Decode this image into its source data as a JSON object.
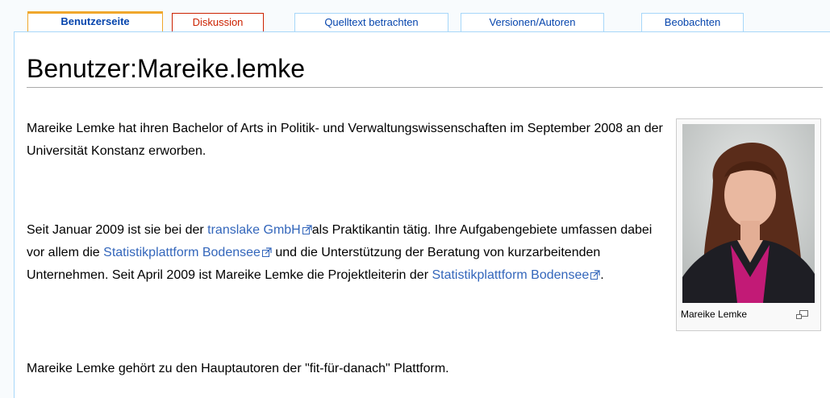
{
  "tabs": [
    {
      "label": "Benutzerseite",
      "state": "active"
    },
    {
      "label": "Diskussion",
      "state": "new"
    },
    {
      "label": "Quelltext betrachten",
      "state": "normal"
    },
    {
      "label": "Versionen/Autoren",
      "state": "normal"
    },
    {
      "label": "Beobachten",
      "state": "normal"
    }
  ],
  "page": {
    "title": "Benutzer:Mareike.lemke"
  },
  "paragraphs": {
    "p1": "Mareike Lemke hat ihren Bachelor of Arts in Politik- und Verwaltungswissenschaften im September 2008 an der Universität Konstanz erworben.",
    "p2_a": "Seit Januar 2009 ist sie bei der ",
    "p2_link1": "translake GmbH",
    "p2_b": "als Praktikantin tätig. Ihre Aufgabengebiete umfassen dabei vor allem die ",
    "p2_link2": "Statistikplattform Bodensee",
    "p2_c": " und die Unterstützung der Beratung von kurzarbeitenden Unternehmen. Seit April 2009 ist Mareike Lemke die Projektleiterin der ",
    "p2_link3": "Statistikplattform Bodensee",
    "p2_d": ".",
    "p3": "Mareike Lemke gehört zu den Hauptautoren der \"fit-für-danach\" Plattform."
  },
  "thumbnail": {
    "caption": "Mareike Lemke",
    "icon": "magnify-clip-icon"
  },
  "icons": {
    "external_link": "external-link-icon"
  },
  "colors": {
    "link": "#3366bb",
    "new_link": "#cc2200",
    "active_tab_accent": "#f0a72c",
    "tab_border": "#a7d7f9",
    "page_background": "#f8fbfd"
  }
}
